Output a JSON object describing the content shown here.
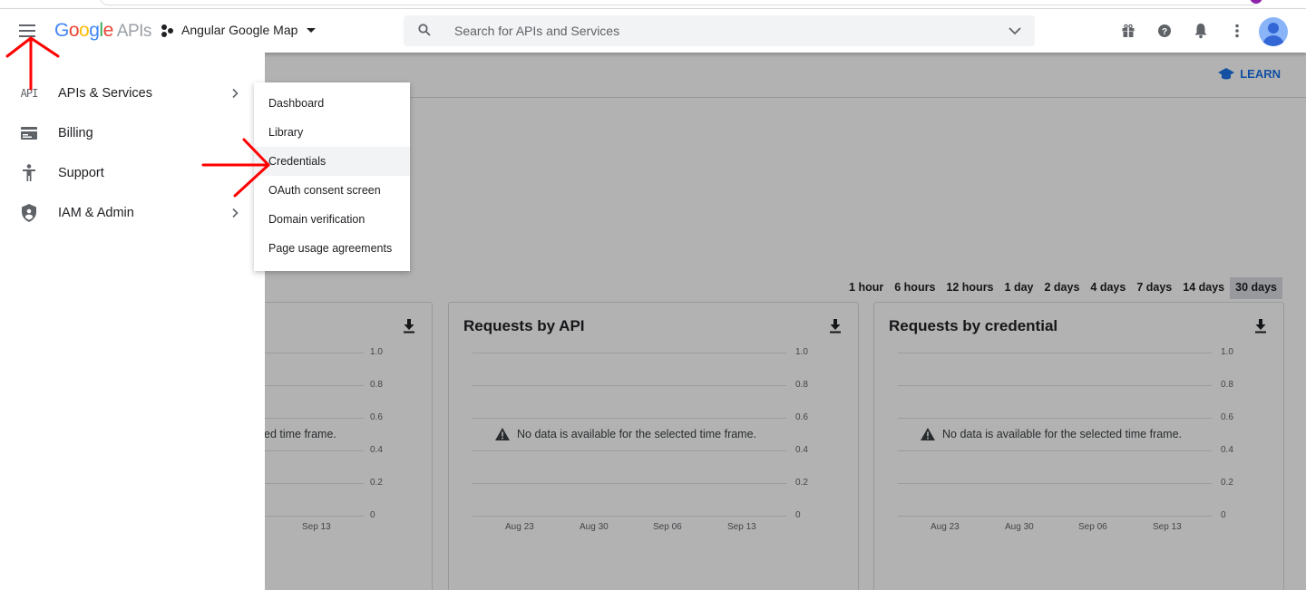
{
  "header": {
    "logo": {
      "g1": "G",
      "g2": "o",
      "g3": "o",
      "g4": "g",
      "g5": "l",
      "g6": "e",
      "suffix": "APIs"
    },
    "project_name": "Angular Google Map",
    "search_placeholder": "Search for APIs and Services",
    "icons": [
      "menu-icon",
      "gift-icon",
      "help-icon",
      "notifications-icon",
      "more-vert-icon"
    ]
  },
  "subbar": {
    "learn_label": "LEARN"
  },
  "nav": {
    "items": [
      {
        "icon": "api-icon",
        "icon_text": "API",
        "label": "APIs & Services",
        "has_submenu": true
      },
      {
        "icon": "billing-icon",
        "label": "Billing",
        "has_submenu": false
      },
      {
        "icon": "support-icon",
        "label": "Support",
        "has_submenu": false
      },
      {
        "icon": "shield-icon",
        "label": "IAM & Admin",
        "has_submenu": true
      }
    ]
  },
  "submenu": {
    "items": [
      "Dashboard",
      "Library",
      "Credentials",
      "OAuth consent screen",
      "Domain verification",
      "Page usage agreements"
    ],
    "highlighted": "Credentials"
  },
  "time_range": {
    "options": [
      "1 hour",
      "6 hours",
      "12 hours",
      "1 day",
      "2 days",
      "4 days",
      "7 days",
      "14 days",
      "30 days"
    ],
    "selected": "30 days"
  },
  "cards": [
    {
      "title": "",
      "nodata": "ed time frame.",
      "y_ticks": [
        "1.0",
        "0.8",
        "0.6",
        "0.4",
        "0.2",
        "0"
      ],
      "x_ticks": [
        "Sep 13"
      ]
    },
    {
      "title": "Requests by API",
      "nodata": "No data is available for the selected time frame.",
      "y_ticks": [
        "1.0",
        "0.8",
        "0.6",
        "0.4",
        "0.2",
        "0"
      ],
      "x_ticks": [
        "Aug 23",
        "Aug 30",
        "Sep 06",
        "Sep 13"
      ]
    },
    {
      "title": "Requests by credential",
      "nodata": "No data is available for the selected time frame.",
      "y_ticks": [
        "1.0",
        "0.8",
        "0.6",
        "0.4",
        "0.2",
        "0"
      ],
      "x_ticks": [
        "Aug 23",
        "Aug 30",
        "Sep 06",
        "Sep 13"
      ]
    }
  ],
  "colors": {
    "accent": "#1a73e8",
    "annotation_arrow": "#ff0000"
  }
}
